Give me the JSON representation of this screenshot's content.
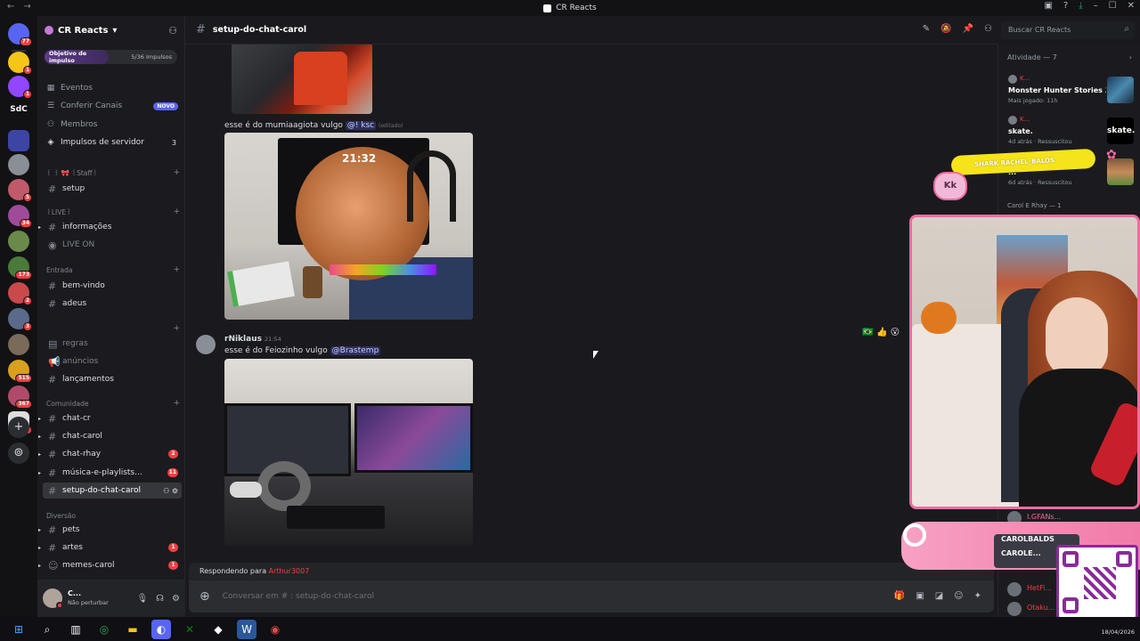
{
  "window": {
    "title": "CR Reacts"
  },
  "rail": {
    "badges": [
      "77",
      "1",
      "1",
      "5",
      "34",
      "173",
      "2",
      "3",
      "515",
      "367",
      "22"
    ],
    "text_server": "SdC"
  },
  "server": {
    "name": "CR Reacts",
    "boost_goal_label": "Objetivo de impulso",
    "boost_count": "5/36 Impulsos",
    "nav": {
      "events": "Eventos",
      "browse": "Conferir Canais",
      "browse_badge": "NOVO",
      "members": "Membros",
      "boosts": "Impulsos de servidor",
      "boosts_count": "3"
    }
  },
  "categories": {
    "staff": "꒰ ꒱ 🎀 ꒰Staff꒱",
    "live": "꒰LIVE꒱",
    "entrada": "Entrada",
    "comunidade": "Comunidade",
    "diversao": "Diversão"
  },
  "channels": {
    "setup": "setup",
    "informacoes": "informações",
    "live_on": "LIVE ON",
    "bem_vindo": "bem-vindo",
    "adeus": "adeus",
    "regras": "regras",
    "anuncios": "anúncios",
    "lancamentos": "lançamentos",
    "chat_cr": "chat-cr",
    "chat_carol": "chat-carol",
    "chat_rhay": "chat-rhay",
    "chat_rhay_count": "2",
    "musica": "música-e-playlists...",
    "musica_count": "11",
    "setup_do_chat": "setup-do-chat-carol",
    "pets": "pets",
    "artes": "artes",
    "artes_count": "1",
    "memes": "memes-carol",
    "memes_count": "1"
  },
  "user": {
    "name": "C...",
    "status": "Não perturbar"
  },
  "channel_header": {
    "name": "setup-do-chat-carol",
    "search_placeholder": "Buscar CR Reacts"
  },
  "messages": {
    "line1_text": "esse é do mumiaagiota vulgo",
    "line1_mention": "@! ksc",
    "line1_edited": "(editado)",
    "clock": "21:32",
    "author": "rNiklaus",
    "time": "21:54",
    "line2_text": "esse é do Feiozinho vulgo",
    "line2_mention": "@Brastemp"
  },
  "reply": {
    "prefix": "Respondendo para",
    "target": "Arthur3007"
  },
  "input": {
    "placeholder": "Conversar em # : setup-do-chat-carol"
  },
  "activity": {
    "header": "Atividade — 7",
    "cards": [
      {
        "user": "K...",
        "game": "Monster Hunter Stories 3: ...",
        "meta": "Mais jogado: 11h"
      },
      {
        "user": "K...",
        "game": "skate.",
        "meta": "4d atrás · Ressuscitou",
        "thumb": "skate."
      },
      {
        "user": "",
        "game": "...",
        "meta": "6d atrás · Ressuscitou"
      }
    ],
    "members_header": "Carol E Rhay — 1",
    "members": [
      "I.GFANs...",
      "HetFi...",
      "Otaku..."
    ]
  },
  "overlay": {
    "banner_text": "SHARK RACHEL_BALOS",
    "kk": "Kk",
    "social1": "CAROLBALDS",
    "social2": "CAROLE..."
  },
  "taskbar": {
    "date": "18/04/2026"
  },
  "colors": {
    "accent": "#5865f2",
    "danger": "#f23f43",
    "stream_pink": "#f06ba0"
  }
}
